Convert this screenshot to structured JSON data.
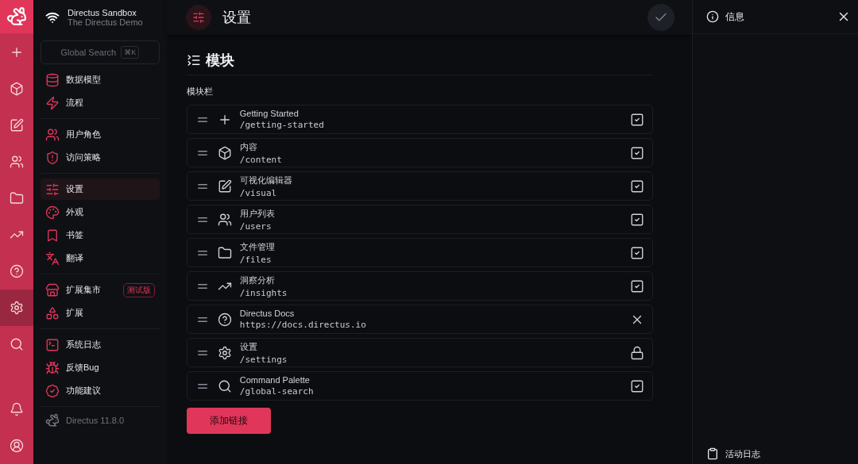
{
  "rail": {
    "top": [
      {
        "selected": false
      },
      {
        "selected": false
      },
      {
        "selected": false
      },
      {
        "selected": false
      },
      {
        "selected": false
      },
      {
        "selected": false
      },
      {
        "selected": false
      },
      {
        "selected": true
      },
      {
        "selected": false
      }
    ],
    "bottom": [
      {
        "selected": false
      },
      {
        "selected": false
      }
    ]
  },
  "project": {
    "name": "Directus Sandbox",
    "subtitle": "The Directus Demo"
  },
  "search": {
    "placeholder": "Global Search",
    "shortcut": "⌘K"
  },
  "nav_groups": [
    {
      "items": [
        {
          "label": "数据模型",
          "selected": false
        },
        {
          "label": "流程",
          "selected": false
        }
      ]
    },
    {
      "items": [
        {
          "label": "用户角色",
          "selected": false
        },
        {
          "label": "访问策略",
          "selected": false
        }
      ]
    },
    {
      "items": [
        {
          "label": "设置",
          "selected": true
        },
        {
          "label": "外观",
          "selected": false
        },
        {
          "label": "书签",
          "selected": false
        },
        {
          "label": "翻译",
          "selected": false
        }
      ]
    },
    {
      "items": [
        {
          "label": "扩展集市",
          "selected": false,
          "badge": "测试版"
        },
        {
          "label": "扩展",
          "selected": false
        }
      ]
    },
    {
      "items": [
        {
          "label": "系统日志",
          "selected": false
        },
        {
          "label": "反馈Bug",
          "selected": false
        },
        {
          "label": "功能建议",
          "selected": false
        }
      ]
    }
  ],
  "version": "Directus 11.8.0",
  "header": {
    "title": "设置"
  },
  "section": {
    "title": "模块",
    "label": "模块栏"
  },
  "modules": [
    {
      "name": "Getting Started",
      "path": "/getting-started",
      "kind": "checkbox",
      "checked": true
    },
    {
      "name": "内容",
      "path": "/content",
      "kind": "checkbox",
      "checked": true
    },
    {
      "name": "可视化编辑器",
      "path": "/visual",
      "kind": "checkbox",
      "checked": true
    },
    {
      "name": "用户列表",
      "path": "/users",
      "kind": "checkbox",
      "checked": true
    },
    {
      "name": "文件管理",
      "path": "/files",
      "kind": "checkbox",
      "checked": true
    },
    {
      "name": "洞察分析",
      "path": "/insights",
      "kind": "checkbox",
      "checked": true
    },
    {
      "name": "Directus Docs",
      "path": "https://docs.directus.io",
      "kind": "remove"
    },
    {
      "name": "设置",
      "path": "/settings",
      "kind": "locked"
    },
    {
      "name": "Command Palette",
      "path": "/global-search",
      "kind": "checkbox",
      "checked": true
    }
  ],
  "add_button": "添加链接",
  "info_panel": {
    "title": "信息",
    "footer": "活动日志"
  }
}
